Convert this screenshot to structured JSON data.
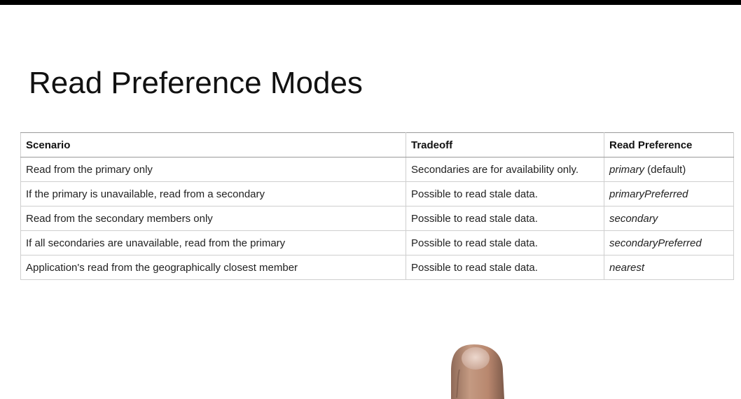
{
  "title": "Read Preference Modes",
  "table": {
    "headers": [
      "Scenario",
      "Tradeoff",
      "Read Preference"
    ],
    "rows": [
      {
        "scenario": "Read from the primary only",
        "tradeoff": "Secondaries are for availability only.",
        "mode": "primary",
        "mode_suffix": " (default)"
      },
      {
        "scenario": "If the primary is unavailable, read from a secondary",
        "tradeoff": "Possible to read stale data.",
        "mode": "primaryPreferred",
        "mode_suffix": ""
      },
      {
        "scenario": "Read from the secondary members only",
        "tradeoff": "Possible to read stale data.",
        "mode": "secondary",
        "mode_suffix": ""
      },
      {
        "scenario": "If all secondaries are unavailable, read from the primary",
        "tradeoff": "Possible to read stale data.",
        "mode": "secondaryPreferred",
        "mode_suffix": ""
      },
      {
        "scenario": "Application's read from the geographically closest member",
        "tradeoff": "Possible to read stale data.",
        "mode": "nearest",
        "mode_suffix": ""
      }
    ]
  },
  "colors": {
    "background": "#ffffff",
    "top_bar": "#000000",
    "text": "#111111",
    "border": "#cfcfcf",
    "header_border": "#9a9a9a",
    "finger": "#c49a82"
  }
}
